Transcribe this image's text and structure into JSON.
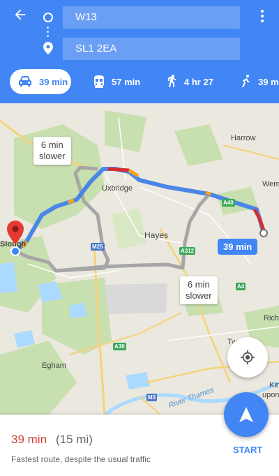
{
  "header": {
    "origin": "W13",
    "destination": "SL1 2EA",
    "icons": {
      "back": "back-arrow-icon",
      "origin": "origin-circle-icon",
      "destination": "destination-pin-icon",
      "more": "more-vert-icon"
    }
  },
  "modes": [
    {
      "id": "drive",
      "label": "39 min",
      "icon": "car-icon",
      "selected": true
    },
    {
      "id": "transit",
      "label": "57 min",
      "icon": "train-icon",
      "selected": false
    },
    {
      "id": "walk",
      "label": "4 hr 27",
      "icon": "walk-icon",
      "selected": false
    },
    {
      "id": "cycle",
      "label": "39 m",
      "icon": "bike-icon",
      "selected": false
    }
  ],
  "map": {
    "places": {
      "harrow": "Harrow",
      "wembley": "Wem",
      "uxbridge": "Uxbridge",
      "hayes": "Hayes",
      "slough": "Slough",
      "egham": "Egham",
      "richmond": "Rich",
      "twickenham": "Tw ham",
      "kingston": "Kin",
      "kingston2": "upon",
      "thames": "River Thames"
    },
    "roads": {
      "m25": "M25",
      "a40": "A40",
      "a312": "A312",
      "a4": "A4",
      "a30": "A30",
      "m3": "M3"
    },
    "callouts": {
      "alt_route_north_line1": "6 min",
      "alt_route_north_line2": "slower",
      "alt_route_south_line1": "6 min",
      "alt_route_south_line2": "slower",
      "route_time": "39 min"
    },
    "colors": {
      "route": "#4a86e8",
      "alt_route": "#a6a6a6",
      "traffic_red": "#d32f2f",
      "traffic_orange": "#f7a11c"
    }
  },
  "sheet": {
    "duration": "39 min",
    "distance": "(15 mi)",
    "description": "Fastest route, despite the usual traffic",
    "start_label": "START"
  },
  "colors": {
    "primary": "#4285f4",
    "duration": "#d23f31"
  }
}
